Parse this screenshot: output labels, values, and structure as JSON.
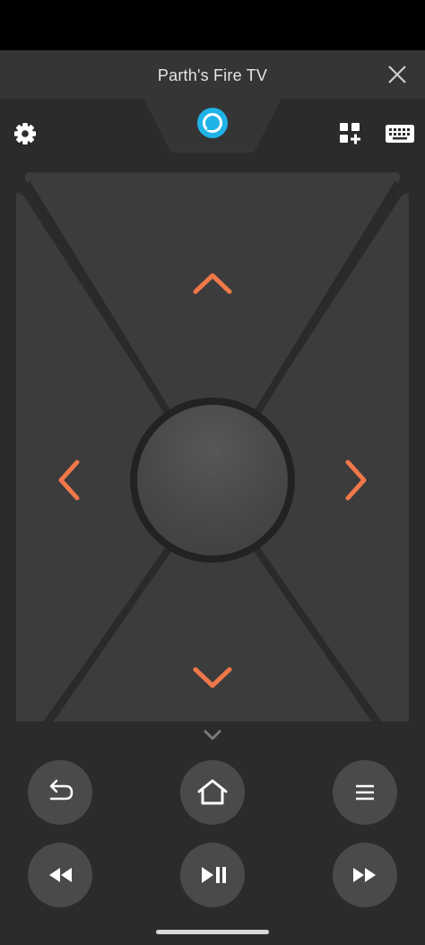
{
  "header": {
    "title": "Parth's Fire TV"
  },
  "icons": {
    "close": "close-icon",
    "alexa": "alexa-icon",
    "settings": "gear-icon",
    "apps": "apps-add-icon",
    "keyboard": "keyboard-icon",
    "dpad_up": "chevron-up-icon",
    "dpad_down": "chevron-down-icon",
    "dpad_left": "chevron-left-icon",
    "dpad_right": "chevron-right-icon",
    "collapse": "chevron-down-icon",
    "back": "back-arrow-icon",
    "home": "home-icon",
    "menu": "hamburger-menu-icon",
    "rewind": "rewind-icon",
    "play_pause": "play-pause-icon",
    "fast_forward": "fast-forward-icon"
  },
  "colors": {
    "accent": "#f0784a",
    "alexa": "#1fb3e8",
    "background": "#2b2b2b",
    "header": "#353535",
    "button": "#4a4a4a"
  }
}
